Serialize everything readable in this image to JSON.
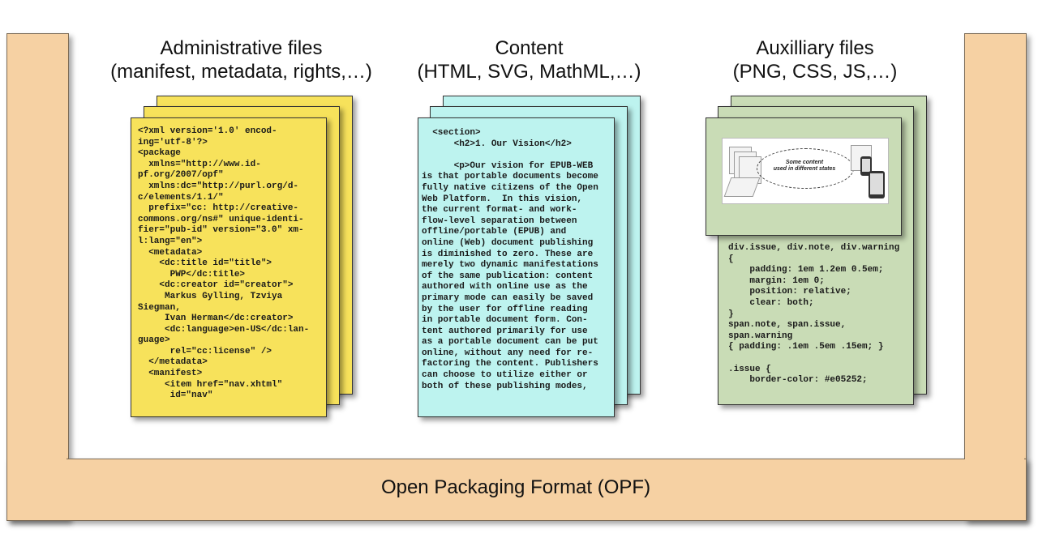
{
  "opf": {
    "label": "Open Packaging Format (OPF)"
  },
  "sections": {
    "admin": {
      "title": "Administrative files",
      "subtitle": "(manifest, metadata, rights,…)",
      "code": "<?xml version='1.0' encod-\ning='utf-8'?>\n<package\n  xmlns=\"http://www.id-\npf.org/2007/opf\"\n  xmlns:dc=\"http://purl.org/d-\nc/elements/1.1/\"\n  prefix=\"cc: http://creative-\ncommons.org/ns#\" unique-identi-\nfier=\"pub-id\" version=\"3.0\" xm-\nl:lang=\"en\">\n  <metadata>\n    <dc:title id=\"title\">\n      PWP</dc:title>\n    <dc:creator id=\"creator\">\n     Markus Gylling, Tzviya\nSiegman,\n     Ivan Herman</dc:creator>\n     <dc:language>en-US</dc:lan-\nguage>\n      rel=\"cc:license\" />\n  </metadata>\n  <manifest>\n     <item href=\"nav.xhtml\"\n      id=\"nav\""
    },
    "content": {
      "title": "Content",
      "subtitle": "(HTML, SVG, MathML,…)",
      "code": "  <section>\n      <h2>1. Our Vision</h2>\n\n      <p>Our vision for EPUB-WEB\nis that portable documents become\nfully native citizens of the Open\nWeb Platform.  In this vision,\nthe current format- and work-\nflow-level separation between\noffline/portable (EPUB) and\nonline (Web) document publishing\nis diminished to zero. These are\nmerely two dynamic manifestations\nof the same publication: content\nauthored with online use as the\nprimary mode can easily be saved\nby the user for offline reading\nin portable document form. Con-\ntent authored primarily for use\nas a portable document can be put\nonline, without any need for re-\nfactoring the content. Publishers\ncan choose to utilize either or\nboth of these publishing modes,"
    },
    "aux": {
      "title": "Auxilliary files",
      "subtitle": "(PNG, CSS, JS,…)",
      "code": "div.issue, div.note, div.warning\n{\n    padding: 1em 1.2em 0.5em;\n    margin: 1em 0;\n    position: relative;\n    clear: both;\n}\nspan.note, span.issue,\nspan.warning\n{ padding: .1em .5em .15em; }\n\n.issue {\n    border-color: #e05252;",
      "thumbnail": {
        "caption_line1": "Some content",
        "caption_line2": "used in different states"
      }
    }
  },
  "colors": {
    "opf": "#f6d1a3",
    "admin_sheet": "#f7e25b",
    "content_sheet": "#bdf3ef",
    "aux_sheet": "#c9dcb6"
  }
}
